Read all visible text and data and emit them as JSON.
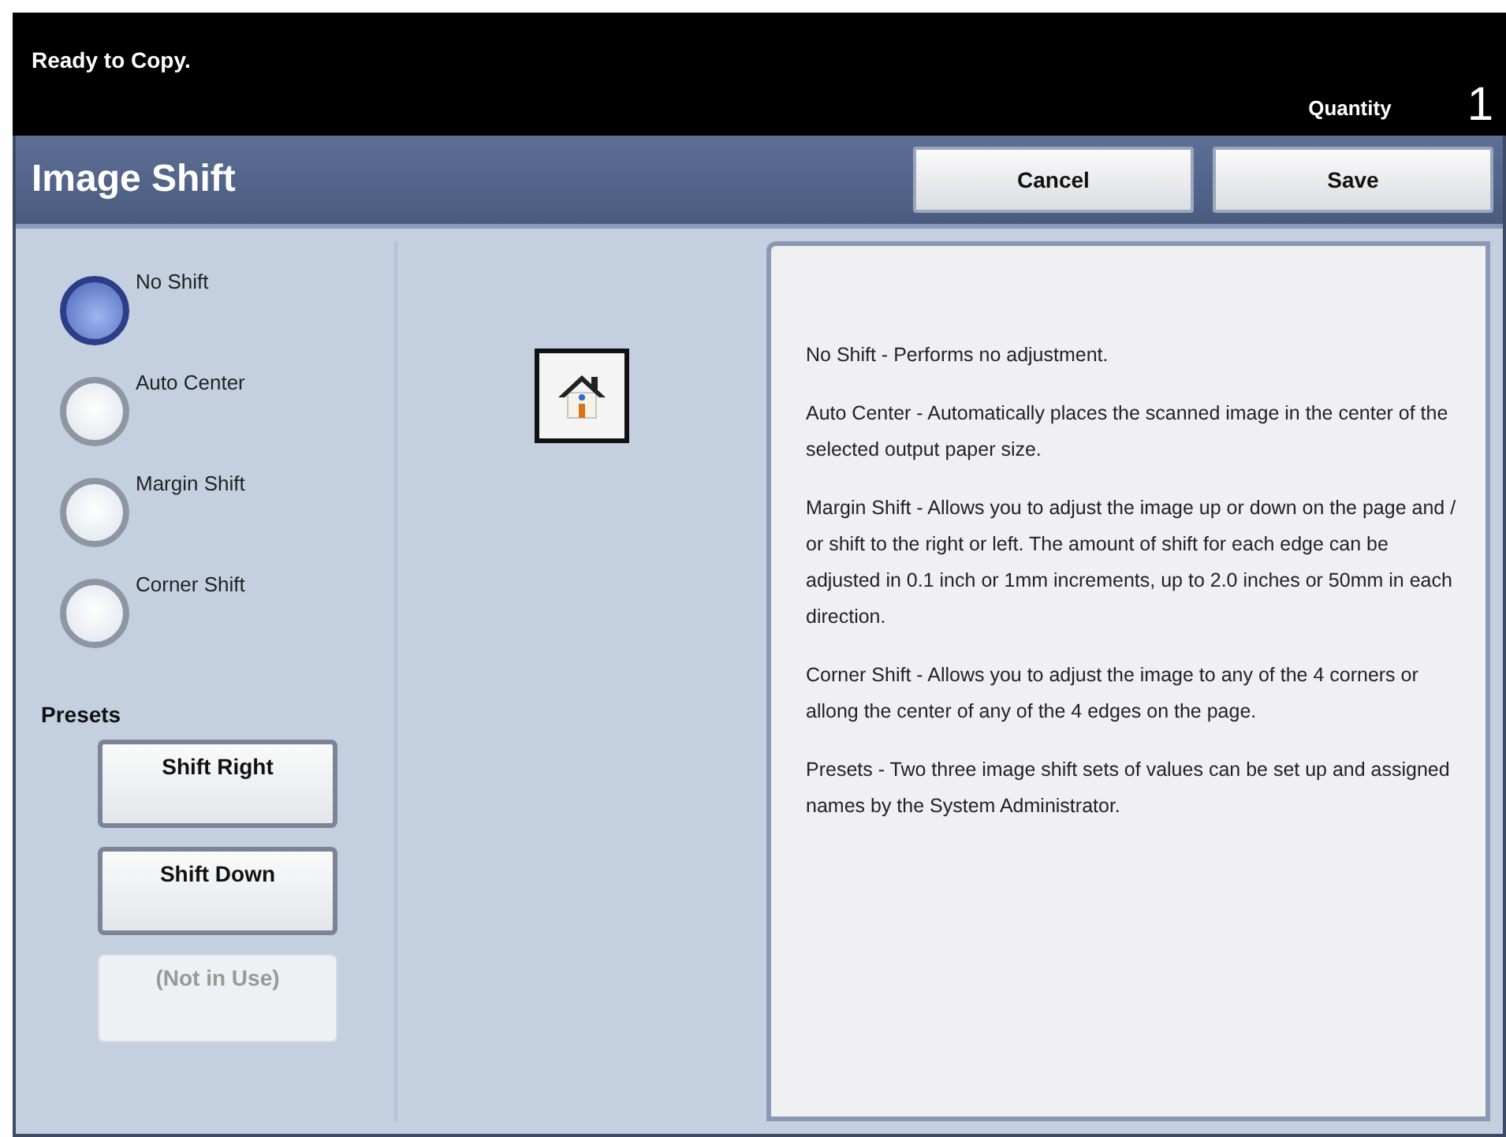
{
  "status": {
    "message": "Ready to Copy.",
    "quantity_label": "Quantity",
    "quantity": "1"
  },
  "header": {
    "title": "Image Shift",
    "buttons": [
      "Cancel",
      "Save"
    ]
  },
  "options": [
    {
      "label": "No Shift",
      "selected": true
    },
    {
      "label": "Auto Center",
      "selected": false
    },
    {
      "label": "Margin Shift",
      "selected": false
    },
    {
      "label": "Corner Shift",
      "selected": false
    }
  ],
  "presets": {
    "title": "Presets",
    "buttons": [
      {
        "label": "Shift Right",
        "disabled": false
      },
      {
        "label": "Shift Down",
        "disabled": false
      },
      {
        "label": "(Not in Use)",
        "disabled": true
      }
    ]
  },
  "help": [
    "No Shift - Performs no adjustment.",
    "Auto Center - Automatically places the scanned image in the center of the selected output paper size.",
    "Margin Shift - Allows you to adjust the image up or down on the page and / or shift to the right or left. The amount of shift for each edge can be adjusted in 0.1 inch or 1mm increments, up to 2.0 inches or 50mm in each direction.",
    "Corner Shift - Allows you to adjust the image to any of the 4 corners or allong the center of any of the 4 edges on the page.",
    "Presets - Two  three image shift sets of values can be set up and assigned names by the System Administrator."
  ]
}
